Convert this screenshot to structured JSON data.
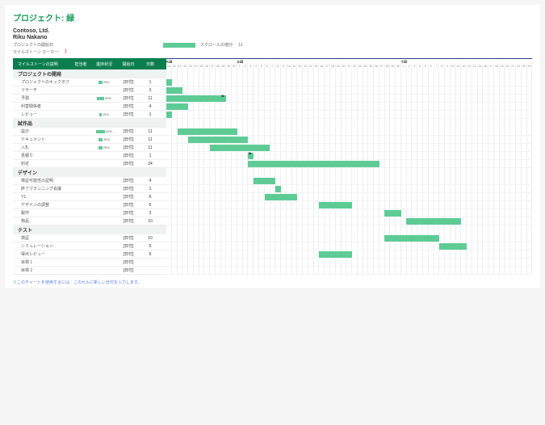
{
  "title": "プロジェクト: 緑",
  "company": "Contoso, Ltd.",
  "lead": "Riku Nakano",
  "meta": {
    "start_label": "プロジェクトの開始日:",
    "marker_label": "マイルストーン マーカー:",
    "marker_value": "1",
    "scroll_label": "スクロールの増分:",
    "scroll_value": "11"
  },
  "columns": {
    "name": "マイルストーンの説明",
    "assignee": "担当者",
    "progress": "進捗状況",
    "start": "開始日",
    "days": "日数"
  },
  "months": [
    "5月",
    "6月",
    "7月"
  ],
  "dates": [
    "19",
    "20",
    "21",
    "22",
    "23",
    "24",
    "25",
    "26",
    "27",
    "28",
    "29",
    "30",
    "31",
    "1",
    "2",
    "3",
    "4",
    "5",
    "6",
    "7",
    "8",
    "9",
    "10",
    "11",
    "12",
    "13",
    "14",
    "15",
    "16",
    "17",
    "18",
    "19",
    "20",
    "21",
    "22",
    "23",
    "24",
    "25",
    "26",
    "27",
    "28",
    "29",
    "30",
    "1",
    "2",
    "3",
    "4",
    "5",
    "6",
    "7",
    "8",
    "9",
    "10",
    "11",
    "12",
    "13",
    "14",
    "15",
    "16",
    "17",
    "18",
    "19",
    "20",
    "21",
    "22",
    "23",
    "24"
  ],
  "sections": [
    {
      "name": "プロジェクトの開発",
      "rows": [
        {
          "name": "プロジェクトのキックオフ",
          "prog": 25,
          "start": "[日付]",
          "days": 1
        },
        {
          "name": "リサーチ",
          "prog": null,
          "start": "[日付]",
          "days": 3
        },
        {
          "name": "予測",
          "prog": 50,
          "start": "[日付]",
          "days": 11
        },
        {
          "name": "利害関係者",
          "prog": null,
          "start": "[日付]",
          "days": 4
        },
        {
          "name": "レビュー",
          "prog": 15,
          "start": "[日付]",
          "days": 1
        }
      ]
    },
    {
      "name": "試作品",
      "rows": [
        {
          "name": "設計",
          "prog": 60,
          "start": "[日付]",
          "days": 11
        },
        {
          "name": "ドキュメント",
          "prog": 30,
          "start": "[日付]",
          "days": 11
        },
        {
          "name": "入札",
          "prog": 25,
          "start": "[日付]",
          "days": 11
        },
        {
          "name": "見積り",
          "prog": null,
          "start": "[日付]",
          "days": 1
        },
        {
          "name": "約定",
          "prog": null,
          "start": "[日付]",
          "days": 24
        }
      ]
    },
    {
      "name": "デザイン",
      "rows": [
        {
          "name": "検証可能性の証明",
          "prog": null,
          "start": "[日付]",
          "days": 4
        },
        {
          "name": "終了ブランニング会議",
          "prog": null,
          "start": "[日付]",
          "days": 1
        },
        {
          "name": "Y1",
          "prog": null,
          "start": "[日付]",
          "days": 6
        },
        {
          "name": "デザインの調整",
          "prog": null,
          "start": "[日付]",
          "days": 6
        },
        {
          "name": "製作",
          "prog": null,
          "start": "[日付]",
          "days": 3
        },
        {
          "name": "物品",
          "prog": null,
          "start": "[日付]",
          "days": 10
        }
      ]
    },
    {
      "name": "テスト",
      "rows": [
        {
          "name": "検証",
          "prog": null,
          "start": "[日付]",
          "days": 10
        },
        {
          "name": "シミュレーション",
          "prog": null,
          "start": "[日付]",
          "days": 5
        },
        {
          "name": "得点レビュー",
          "prog": null,
          "start": "[日付]",
          "days": 6
        },
        {
          "name": "目標 1",
          "prog": null,
          "start": "[日付]",
          "days": ""
        },
        {
          "name": "目標 2",
          "prog": null,
          "start": "[日付]",
          "days": ""
        }
      ]
    }
  ],
  "note": "※このチャートを使用するには、このセルに新しい日付を入力します。",
  "colors": {
    "primary": "#5ecb95",
    "header": "#0b7e4f",
    "accent": "#1a9b5a",
    "timeline": "#2c3e8f"
  },
  "chart_data": {
    "type": "gantt",
    "title": "プロジェクト: 緑",
    "x_unit": "day",
    "x_start": "05-19",
    "x_end": "07-24",
    "months": [
      {
        "label": "5月",
        "start_index": 0
      },
      {
        "label": "6月",
        "start_index": 13
      },
      {
        "label": "7月",
        "start_index": 43
      }
    ],
    "tasks": [
      {
        "group": "プロジェクトの開発",
        "name": "プロジェクトのキックオフ",
        "start_index": 0,
        "duration": 1,
        "progress": 25
      },
      {
        "group": "プロジェクトの開発",
        "name": "リサーチ",
        "start_index": 0,
        "duration": 3
      },
      {
        "group": "プロジェクトの開発",
        "name": "予測",
        "start_index": 0,
        "duration": 11,
        "progress": 50,
        "milestone_at": 10
      },
      {
        "group": "プロジェクトの開発",
        "name": "利害関係者",
        "start_index": 0,
        "duration": 4
      },
      {
        "group": "プロジェクトの開発",
        "name": "レビュー",
        "start_index": 0,
        "duration": 1,
        "progress": 15
      },
      {
        "group": "試作品",
        "name": "設計",
        "start_index": 2,
        "duration": 11,
        "progress": 60
      },
      {
        "group": "試作品",
        "name": "ドキュメント",
        "start_index": 4,
        "duration": 11,
        "progress": 30
      },
      {
        "group": "試作品",
        "name": "入札",
        "start_index": 8,
        "duration": 11,
        "progress": 25
      },
      {
        "group": "試作品",
        "name": "見積り",
        "start_index": 15,
        "duration": 1,
        "milestone_at": 15
      },
      {
        "group": "試作品",
        "name": "約定",
        "start_index": 15,
        "duration": 24
      },
      {
        "group": "デザイン",
        "name": "検証可能性の証明",
        "start_index": 16,
        "duration": 4
      },
      {
        "group": "デザイン",
        "name": "終了ブランニング会議",
        "start_index": 20,
        "duration": 1
      },
      {
        "group": "デザイン",
        "name": "Y1",
        "start_index": 18,
        "duration": 6
      },
      {
        "group": "デザイン",
        "name": "デザインの調整",
        "start_index": 28,
        "duration": 6
      },
      {
        "group": "デザイン",
        "name": "製作",
        "start_index": 40,
        "duration": 3
      },
      {
        "group": "デザイン",
        "name": "物品",
        "start_index": 44,
        "duration": 10
      },
      {
        "group": "テスト",
        "name": "検証",
        "start_index": 40,
        "duration": 10
      },
      {
        "group": "テスト",
        "name": "シミュレーション",
        "start_index": 50,
        "duration": 5
      },
      {
        "group": "テスト",
        "name": "得点レビュー",
        "start_index": 28,
        "duration": 6
      }
    ]
  }
}
